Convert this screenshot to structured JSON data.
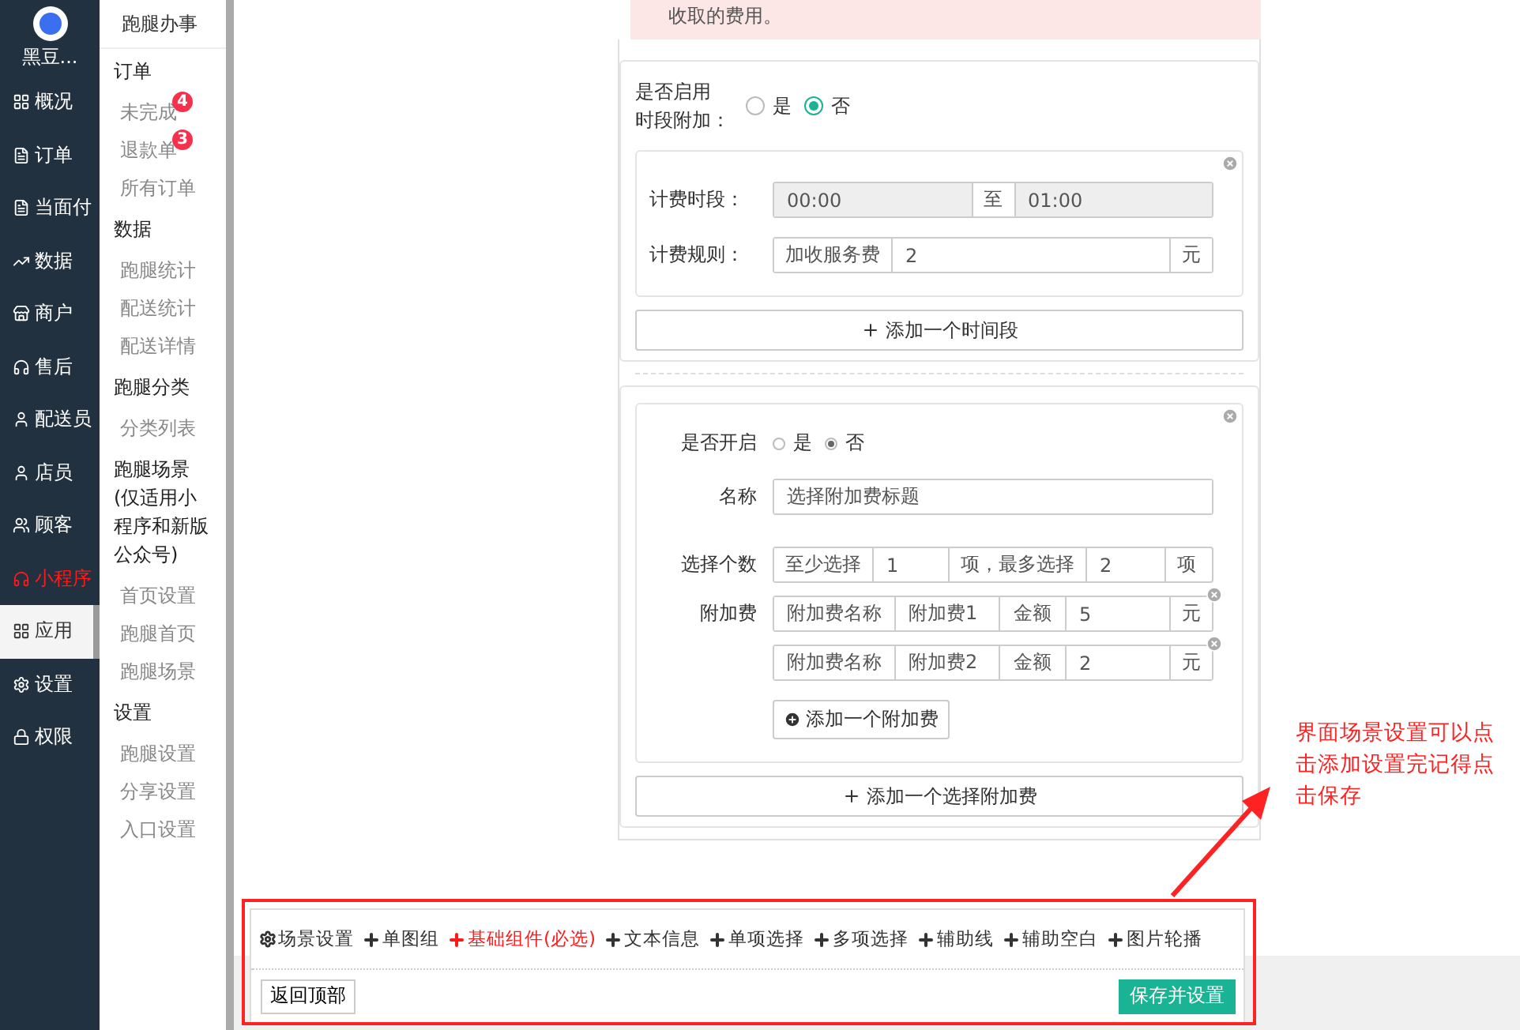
{
  "brand": {
    "name": "黑豆..."
  },
  "nav": [
    {
      "label": "概况",
      "selected": false,
      "highlight": false
    },
    {
      "label": "订单",
      "selected": false,
      "highlight": false
    },
    {
      "label": "当面付",
      "selected": false,
      "highlight": false
    },
    {
      "label": "数据",
      "selected": false,
      "highlight": false
    },
    {
      "label": "商户",
      "selected": false,
      "highlight": false
    },
    {
      "label": "售后",
      "selected": false,
      "highlight": false
    },
    {
      "label": "配送员",
      "selected": false,
      "highlight": false
    },
    {
      "label": "店员",
      "selected": false,
      "highlight": false
    },
    {
      "label": "顾客",
      "selected": false,
      "highlight": false
    },
    {
      "label": "小程序",
      "selected": false,
      "highlight": true
    },
    {
      "label": "应用",
      "selected": true,
      "highlight": false
    },
    {
      "label": "设置",
      "selected": false,
      "highlight": false
    },
    {
      "label": "权限",
      "selected": false,
      "highlight": false
    }
  ],
  "submenu": {
    "title": "跑腿办事",
    "groups": [
      {
        "heading": "订单",
        "items": [
          {
            "label": "未完成",
            "badge": "4"
          },
          {
            "label": "退款单",
            "badge": "3"
          },
          {
            "label": "所有订单"
          }
        ]
      },
      {
        "heading": "数据",
        "items": [
          {
            "label": "跑腿统计"
          },
          {
            "label": "配送统计"
          },
          {
            "label": "配送详情"
          }
        ]
      },
      {
        "heading": "跑腿分类",
        "items": [
          {
            "label": "分类列表"
          }
        ]
      },
      {
        "heading": "跑腿场景(仅适用小程序和新版公众号)",
        "items": [
          {
            "label": "首页设置"
          },
          {
            "label": "跑腿首页"
          },
          {
            "label": "跑腿场景"
          }
        ]
      },
      {
        "heading": "设置",
        "items": [
          {
            "label": "跑腿设置"
          },
          {
            "label": "分享设置"
          },
          {
            "label": "入口设置"
          }
        ]
      }
    ]
  },
  "notice": "收取的费用。",
  "time_section": {
    "label_lines": [
      "是否启用",
      "时段附加："
    ],
    "options": [
      {
        "label": "是",
        "selected": false
      },
      {
        "label": "否",
        "selected": true
      }
    ],
    "period": {
      "label": "计费时段：",
      "from": "00:00",
      "sep": "至",
      "to": "01:00"
    },
    "rule": {
      "label": "计费规则：",
      "prefix": "加收服务费",
      "value": "2",
      "unit": "元"
    },
    "add_button": "添加一个时间段"
  },
  "extra_section": {
    "enable_label": "是否开启",
    "options": [
      {
        "label": "是",
        "selected": false
      },
      {
        "label": "否",
        "selected": true
      }
    ],
    "name_label": "名称",
    "name_value": "选择附加费标题",
    "count": {
      "label": "选择个数",
      "min_prefix": "至少选择",
      "min": "1",
      "mid": "项，最多选择",
      "max": "2",
      "unit": "项"
    },
    "fees_label": "附加费",
    "fees": [
      {
        "name_label": "附加费名称",
        "name": "附加费1",
        "amount_label": "金额",
        "amount": "5",
        "unit": "元"
      },
      {
        "name_label": "附加费名称",
        "name": "附加费2",
        "amount_label": "金额",
        "amount": "2",
        "unit": "元"
      }
    ],
    "add_fee": "添加一个附加费",
    "add_button": "添加一个选择附加费"
  },
  "toolbar": {
    "items": [
      {
        "label": "场景设置",
        "kind": "settings",
        "highlight": false
      },
      {
        "label": "单图组",
        "kind": "add",
        "highlight": false
      },
      {
        "label": "基础组件(必选)",
        "kind": "add",
        "highlight": true
      },
      {
        "label": "文本信息",
        "kind": "add",
        "highlight": false
      },
      {
        "label": "单项选择",
        "kind": "add",
        "highlight": false
      },
      {
        "label": "多项选择",
        "kind": "add",
        "highlight": false
      },
      {
        "label": "辅助线",
        "kind": "add",
        "highlight": false
      },
      {
        "label": "辅助空白",
        "kind": "add",
        "highlight": false
      },
      {
        "label": "图片轮播",
        "kind": "add",
        "highlight": false
      }
    ],
    "back": "返回顶部",
    "save": "保存并设置"
  },
  "annotation": {
    "text": "界面场景设置可以点击添加设置完记得点击保存"
  }
}
